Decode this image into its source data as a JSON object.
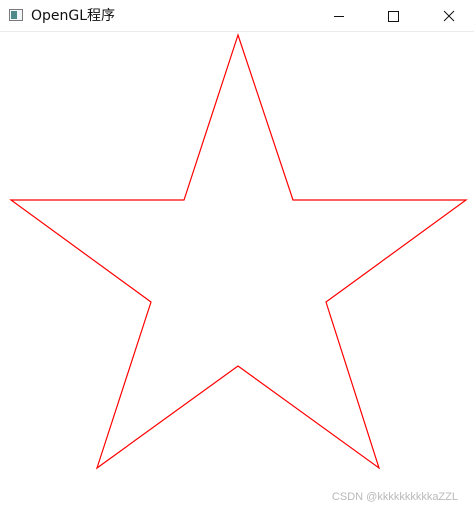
{
  "window": {
    "title": "OpenGL程序",
    "app_icon": "opengl-window-icon",
    "controls": {
      "minimize_icon": "minimize-icon",
      "maximize_icon": "maximize-icon",
      "close_icon": "close-icon"
    }
  },
  "canvas": {
    "background": "#ffffff",
    "shape": "five-pointed-star-outline",
    "stroke_color": "#ff0000"
  },
  "watermark": "CSDN @kkkkkkkkkkaZZL"
}
